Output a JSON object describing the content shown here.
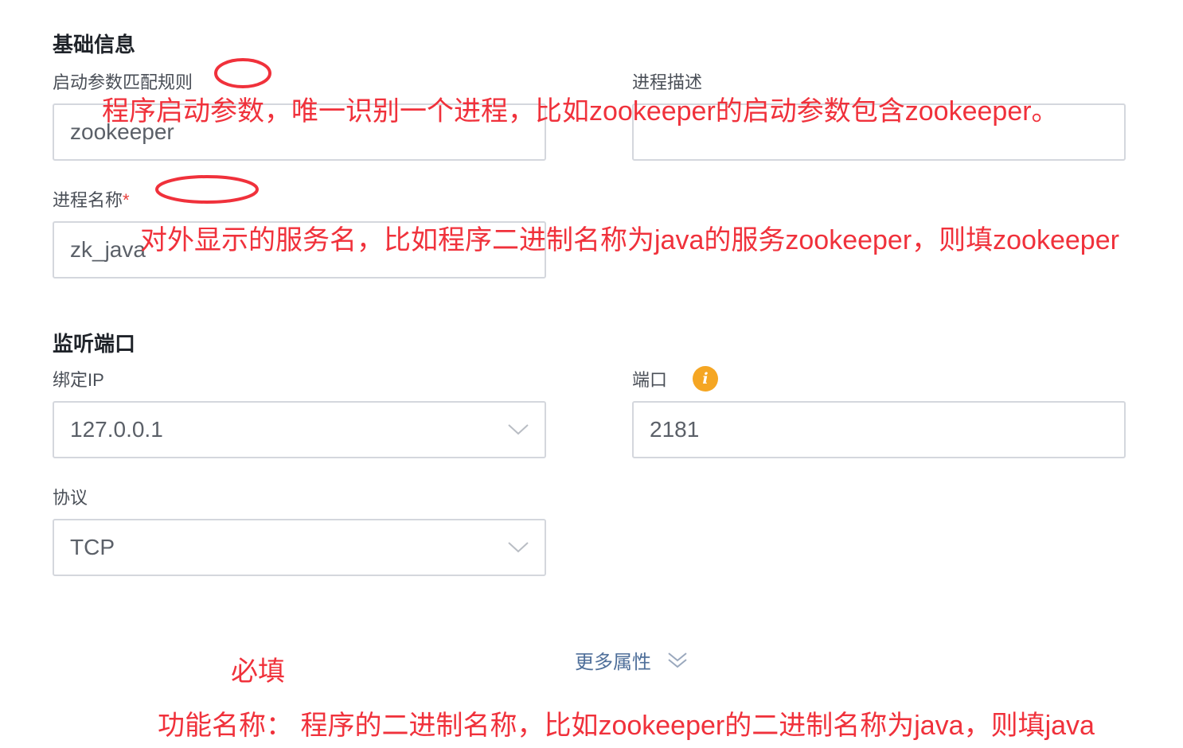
{
  "basic_info": {
    "title": "基础信息",
    "start_param_rule": {
      "label": "启动参数匹配规则",
      "value": "zookeeper"
    },
    "process_desc": {
      "label": "进程描述",
      "value": ""
    },
    "process_name": {
      "label": "进程名称",
      "required_mark": "*",
      "value": "zk_java"
    }
  },
  "listen_port": {
    "title": "监听端口",
    "bind_ip": {
      "label": "绑定IP",
      "value": "127.0.0.1",
      "icon": "chevron-down-icon"
    },
    "port": {
      "label": "端口",
      "value": "2181",
      "info_icon_glyph": "i"
    },
    "protocol": {
      "label": "协议",
      "value": "TCP",
      "icon": "chevron-down-icon"
    }
  },
  "more_properties": {
    "label": "更多属性",
    "icon": "double-chevron-down-icon"
  },
  "annotations": {
    "start_param_note": "程序启动参数，唯一识别一个进程，比如zookeeper的启动参数包含zookeeper。",
    "process_name_note": "对外显示的服务名，比如程序二进制名称为java的服务zookeeper，则填zookeeper",
    "required_note": "必填",
    "function_name_note": "功能名称： 程序的二进制名称，比如zookeeper的二进制名称为java，则填java",
    "highlight_color": "#f0313b"
  },
  "colors": {
    "input_border": "#d4d7dd",
    "label_text": "#4a4f57",
    "title_text": "#1f2329",
    "info_icon": "#f5a623",
    "link_text": "#4f6f9a"
  }
}
